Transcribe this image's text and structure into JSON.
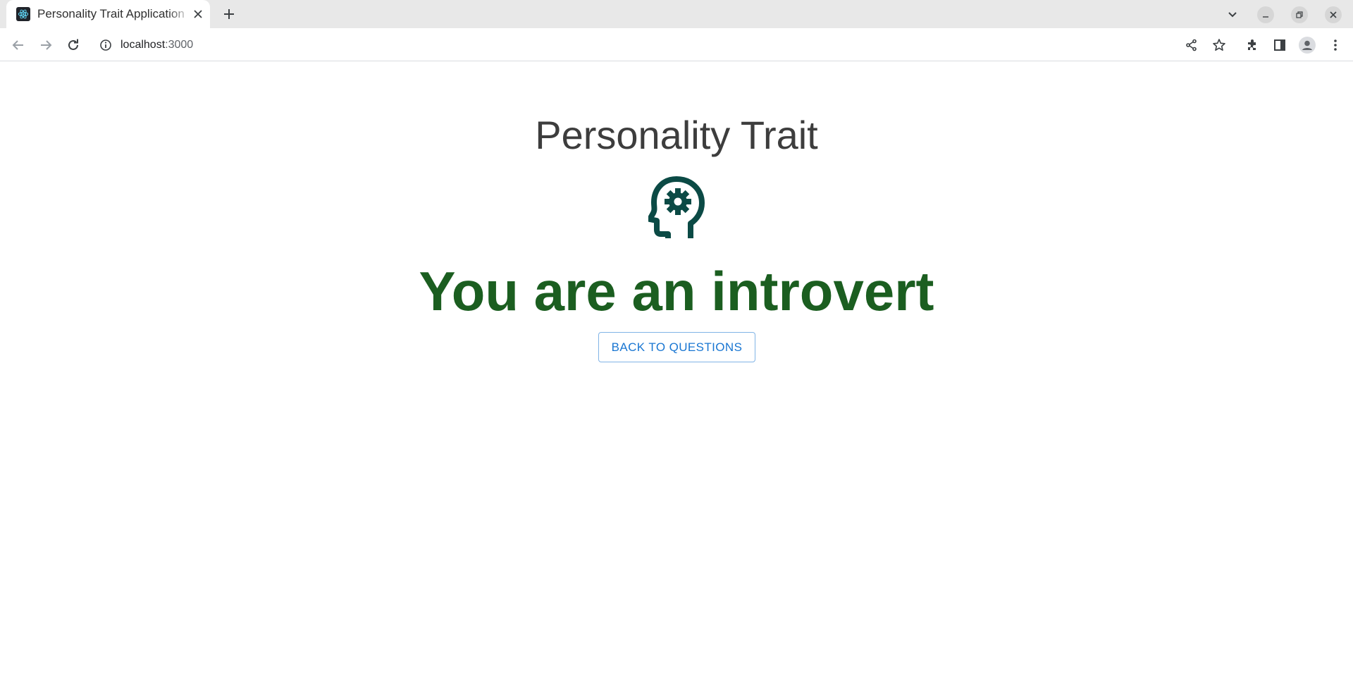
{
  "browser": {
    "tab": {
      "title": "Personality Trait Application",
      "favicon": "react-logo-icon"
    },
    "new_tab_icon": "plus-icon",
    "window_controls": [
      "tab-search-icon",
      "minimize-icon",
      "restore-icon",
      "close-icon"
    ],
    "address": {
      "host": "localhost",
      "port": ":3000"
    },
    "toolbar_icons": [
      "back-icon",
      "forward-icon",
      "reload-icon",
      "info-icon",
      "share-icon",
      "star-icon",
      "extensions-icon",
      "side-panel-icon",
      "profile-icon",
      "menu-icon"
    ]
  },
  "page": {
    "title": "Personality Trait",
    "icon": "psychology-head-gear-icon",
    "result_text": "You are an introvert",
    "back_button_label": "BACK TO QUESTIONS"
  },
  "colors": {
    "title": "#3d3d3d",
    "result": "#1b5e20",
    "icon": "#0b4a45",
    "button": "#1976d2"
  }
}
